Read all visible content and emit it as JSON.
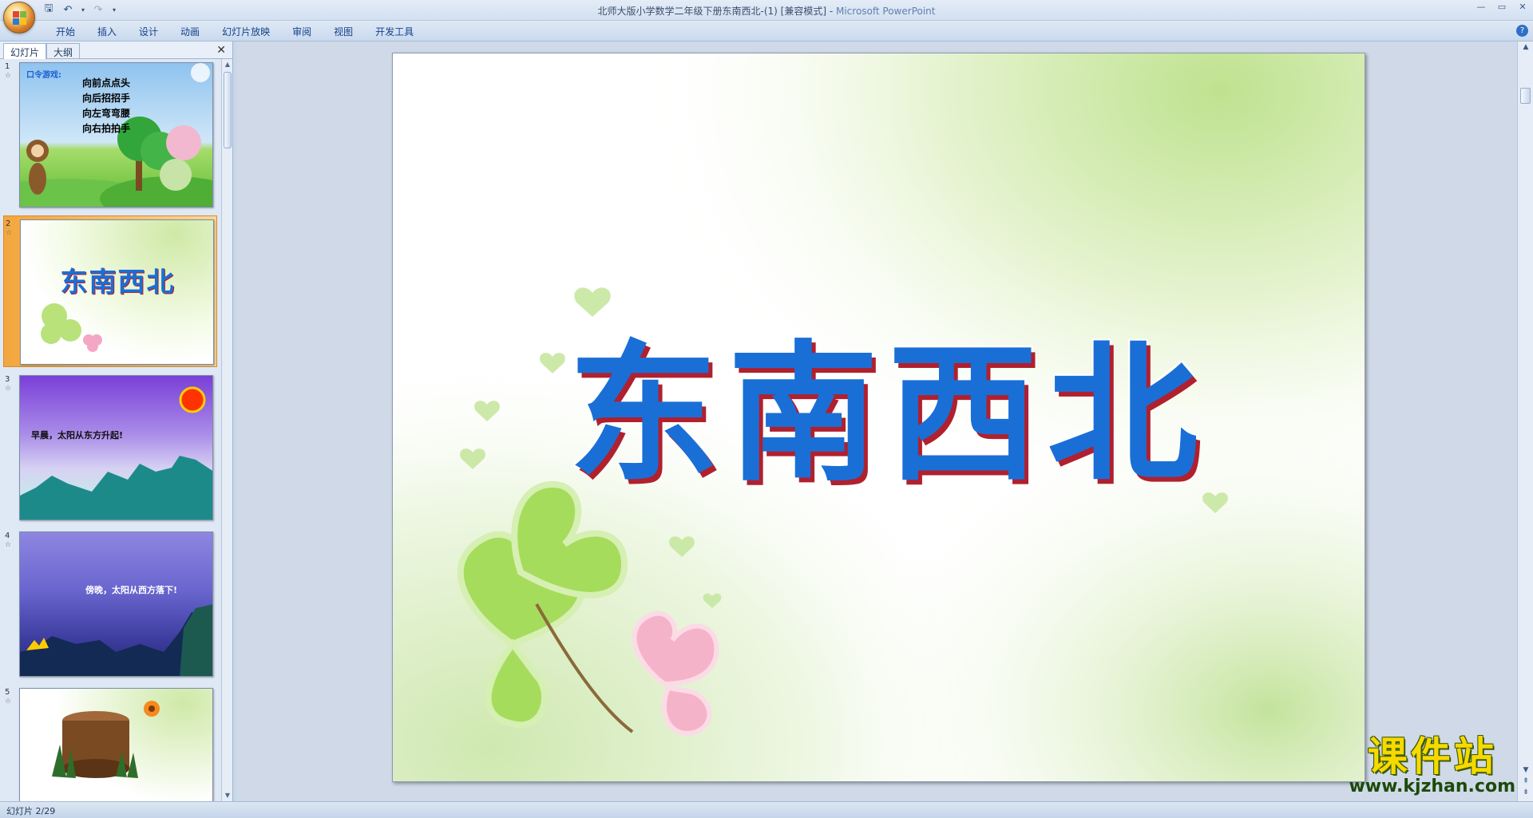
{
  "window": {
    "title": "北师大版小学数学二年级下册东南西北-(1) [兼容模式]",
    "app_name": "Microsoft PowerPoint",
    "title_separator": " - "
  },
  "ribbon": {
    "tabs": [
      "开始",
      "插入",
      "设计",
      "动画",
      "幻灯片放映",
      "审阅",
      "视图",
      "开发工具"
    ]
  },
  "left_pane": {
    "tabs": [
      "幻灯片",
      "大纲"
    ],
    "close_glyph": "✕"
  },
  "thumbnails": [
    {
      "number": "1",
      "lines_title": "口令游戏:",
      "lines": [
        "向前点点头",
        "向后招招手",
        "向左弯弯腰",
        "向右拍拍手"
      ]
    },
    {
      "number": "2",
      "title": "东南西北"
    },
    {
      "number": "3",
      "caption": "早晨，太阳从东方升起!"
    },
    {
      "number": "4",
      "caption": "傍晚，太阳从西方落下!"
    },
    {
      "number": "5"
    }
  ],
  "slide": {
    "title": "东南西北"
  },
  "status": {
    "slide_info": "幻灯片 2/29"
  },
  "watermark": {
    "main": "课件站",
    "url": "www.kjzhan.com"
  },
  "colors": {
    "title_blue": "#1a6fd6",
    "title_shadow": "#b0202e",
    "selected_thumb": "#f3a63e"
  }
}
